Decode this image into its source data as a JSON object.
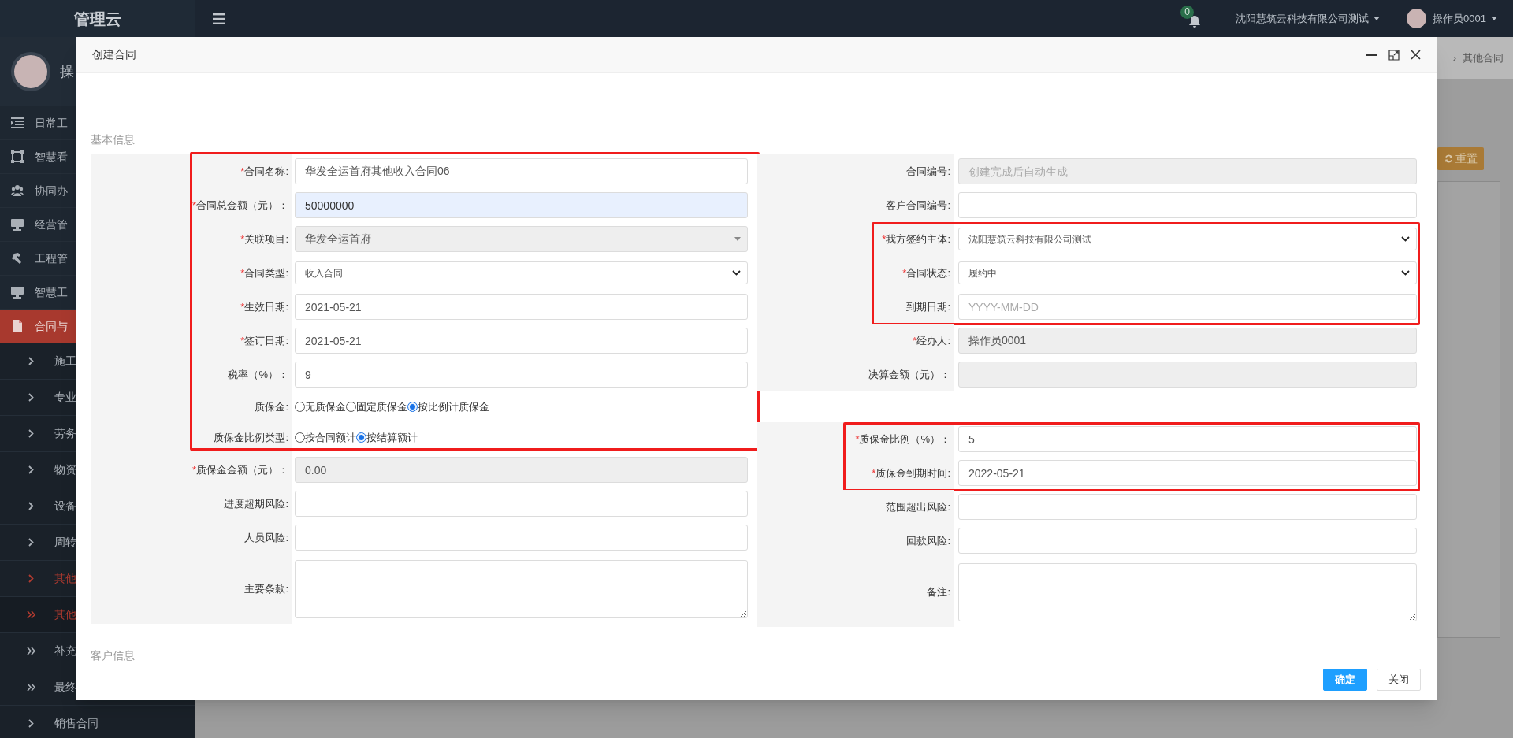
{
  "topbar": {
    "logo": "管理云",
    "company": "沈阳慧筑云科技有限公司测试",
    "user": "操作员0001",
    "notifications": "0"
  },
  "sidebar": {
    "profile_name": "操",
    "items": [
      {
        "kind": "module",
        "label": "日常工",
        "selected": false,
        "active": false
      },
      {
        "kind": "module",
        "label": "智慧看",
        "selected": false,
        "active": false
      },
      {
        "kind": "module",
        "label": "协同办",
        "selected": false,
        "active": false
      },
      {
        "kind": "module",
        "label": "经营管",
        "selected": false,
        "active": false
      },
      {
        "kind": "module",
        "label": "工程管",
        "selected": false,
        "active": false
      },
      {
        "kind": "module",
        "label": "智慧工",
        "selected": false,
        "active": false
      },
      {
        "kind": "module",
        "label": "合同与",
        "selected": true,
        "active": false
      },
      {
        "kind": "link",
        "label": "施工",
        "selected": false,
        "active": false
      },
      {
        "kind": "link",
        "label": "专业",
        "selected": false,
        "active": false
      },
      {
        "kind": "link",
        "label": "劳务",
        "selected": false,
        "active": false
      },
      {
        "kind": "link",
        "label": "物资",
        "selected": false,
        "active": false
      },
      {
        "kind": "link",
        "label": "设备",
        "selected": false,
        "active": false
      },
      {
        "kind": "link",
        "label": "周转",
        "selected": false,
        "active": false
      },
      {
        "kind": "link",
        "label": "其他",
        "selected": false,
        "active": true
      },
      {
        "kind": "group",
        "label": "其他",
        "selected": false,
        "active": true
      },
      {
        "kind": "group",
        "label": "补充",
        "selected": false,
        "active": false
      },
      {
        "kind": "group",
        "label": "最终",
        "selected": false,
        "active": false
      },
      {
        "kind": "link",
        "label": "销售合同",
        "selected": false,
        "active": false
      }
    ]
  },
  "background": {
    "breadcrumb_separator": "›",
    "breadcrumb": "其他合同",
    "reset_button": "重置"
  },
  "modal": {
    "title": "创建合同",
    "section": "基本信息",
    "next_section": "客户信息",
    "left_groups": [
      {
        "highlighted": true,
        "rows": [
          {
            "kind": "input",
            "star": "*",
            "label": "合同名称:",
            "value": "华发全运首府其他收入合同06",
            "disabled": false,
            "autofilled": false
          },
          {
            "kind": "input",
            "star": "*",
            "label": "合同总金额（元）：",
            "value": "50000000",
            "disabled": false,
            "autofilled": true
          },
          {
            "kind": "combo",
            "star": "*",
            "label": "关联项目:",
            "value": "华发全运首府",
            "disabled": true
          },
          {
            "kind": "select",
            "star": "*",
            "label": "合同类型:",
            "value": "收入合同",
            "disabled": false
          },
          {
            "kind": "input",
            "star": "*",
            "label": "生效日期:",
            "value": "2021-05-21",
            "disabled": false,
            "autofilled": false
          },
          {
            "kind": "input",
            "star": "*",
            "label": "签订日期:",
            "value": "2021-05-21",
            "disabled": false,
            "autofilled": false
          },
          {
            "kind": "input",
            "label": "税率（%）：",
            "value": "9",
            "disabled": false,
            "autofilled": false
          },
          {
            "kind": "radio",
            "label": "质保金:",
            "options": [
              {
                "label": "无质保金",
                "selected": false
              },
              {
                "label": "固定质保金",
                "selected": false
              },
              {
                "label": "按比例计质保金",
                "selected": true
              }
            ]
          },
          {
            "kind": "radio",
            "label": "质保金比例类型:",
            "options": [
              {
                "label": "按合同额计",
                "selected": false
              },
              {
                "label": "按结算额计",
                "selected": true
              }
            ]
          }
        ]
      },
      {
        "rows": [
          {
            "kind": "input",
            "star": "*",
            "label": "质保金金额（元）：",
            "value": "0.00",
            "disabled": true
          },
          {
            "kind": "input",
            "label": "进度超期风险:",
            "disabled": false,
            "autofilled": false
          },
          {
            "kind": "input",
            "label": "人员风险:",
            "disabled": false,
            "autofilled": false
          },
          {
            "kind": "textarea",
            "label": "主要条款:",
            "disabled": false
          }
        ]
      }
    ],
    "right_sections": [
      [
        {
          "rows": [
            {
              "kind": "input",
              "label": "合同编号:",
              "placeholder": "创建完成后自动生成",
              "disabled": true
            },
            {
              "kind": "input",
              "label": "客户合同编号:",
              "disabled": false,
              "autofilled": false
            }
          ]
        },
        {
          "highlighted": true,
          "rows": [
            {
              "kind": "select",
              "star": "*",
              "label": "我方签约主体:",
              "value": "沈阳慧筑云科技有限公司测试",
              "disabled": false
            },
            {
              "kind": "select",
              "star": "*",
              "label": "合同状态:",
              "value": "履约中",
              "disabled": false
            },
            {
              "kind": "input",
              "label": "到期日期:",
              "placeholder": "YYYY-MM-DD",
              "disabled": false,
              "autofilled": false
            }
          ]
        },
        {
          "rows": [
            {
              "kind": "input",
              "star": "*",
              "label": "经办人:",
              "value": "操作员0001",
              "disabled": true
            },
            {
              "kind": "input",
              "label": "决算金额（元）：",
              "disabled": true
            }
          ]
        }
      ],
      [
        {
          "highlighted": true,
          "rows": [
            {
              "kind": "input",
              "star": "*",
              "label": "质保金比例（%）：",
              "value": "5",
              "disabled": false,
              "autofilled": false
            },
            {
              "kind": "input",
              "star": "*",
              "label": "质保金到期时间:",
              "value": "2022-05-21",
              "disabled": false,
              "autofilled": false
            }
          ]
        },
        {
          "rows": [
            {
              "kind": "input",
              "label": "范围超出风险:",
              "disabled": false,
              "autofilled": false
            },
            {
              "kind": "input",
              "label": "回款风险:",
              "disabled": false,
              "autofilled": false
            },
            {
              "kind": "textarea",
              "label": "备注:",
              "disabled": false
            }
          ]
        }
      ]
    ],
    "buttons": [
      {
        "label": "确定",
        "primary": true
      },
      {
        "label": "关闭",
        "primary": false
      }
    ]
  }
}
